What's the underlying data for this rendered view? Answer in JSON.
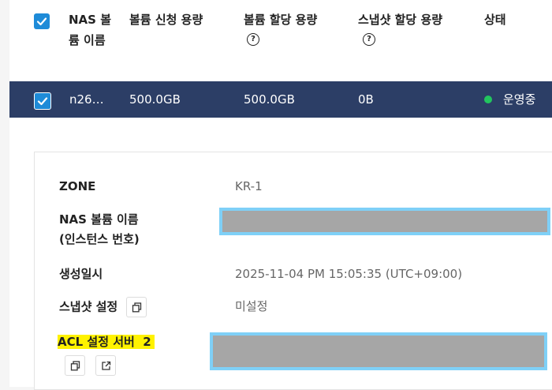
{
  "table": {
    "headers": {
      "name": "NAS 볼륨 이름",
      "requested": "볼륨 신청 용량",
      "allocated": "볼륨 할당 용량",
      "snapshot": "스냅샷 할당 용량",
      "status": "상태"
    },
    "help_glyph": "?",
    "row": {
      "name": "n26…",
      "requested": "500.0GB",
      "allocated": "500.0GB",
      "snapshot": "0B",
      "status": "운영중",
      "status_color": "#22c55e",
      "selected": true
    },
    "header_checked": true
  },
  "detail": {
    "zone_label": "ZONE",
    "zone_value": "KR-1",
    "volume_name_label_line1": "NAS 볼륨 이름",
    "volume_name_label_line2": "(인스턴스 번호)",
    "created_label": "생성일시",
    "created_value": "2025-11-04 PM 15:05:35 (UTC+09:00)",
    "snapshot_label": "스냅샷 설정",
    "snapshot_value": "미설정",
    "acl_label": "ACL 설정 서버",
    "acl_count": "2"
  },
  "colors": {
    "accent": "#1e8bd8",
    "selected_row": "#2c3e66",
    "redaction": "#a6a6a6",
    "redaction_border": "#7fd0f7",
    "highlight": "#fff200"
  },
  "icons": {
    "copy": "copy-icon",
    "external": "external-link-icon",
    "help": "help-circle-icon",
    "check": "check-icon"
  }
}
